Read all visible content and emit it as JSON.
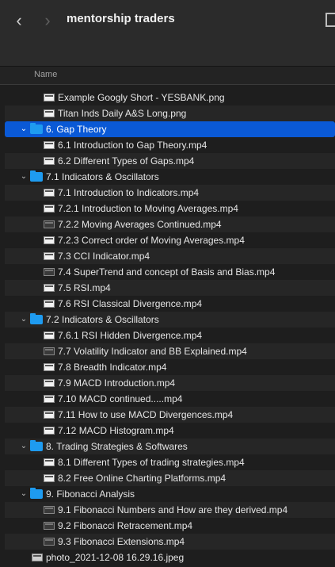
{
  "window": {
    "title": "mentorship traders",
    "column_name": "Name"
  },
  "items": [
    {
      "label": "Example Googly Short - YESBANK.png",
      "kind": "file",
      "indent": 2,
      "alt": false
    },
    {
      "label": "Titan Inds Daily A&S Long.png",
      "kind": "file",
      "indent": 2,
      "alt": true
    },
    {
      "label": "6. Gap Theory",
      "kind": "folder",
      "indent": 1,
      "expanded": true,
      "selected": true
    },
    {
      "label": "6.1 Introduction to Gap Theory.mp4",
      "kind": "file",
      "indent": 2,
      "alt": false
    },
    {
      "label": "6.2 Different Types of Gaps.mp4",
      "kind": "file",
      "indent": 2,
      "alt": true
    },
    {
      "label": "7.1 Indicators & Oscillators",
      "kind": "folder",
      "indent": 1,
      "expanded": true,
      "alt": false
    },
    {
      "label": "7.1 Introduction to Indicators.mp4",
      "kind": "file",
      "indent": 2,
      "alt": true
    },
    {
      "label": "7.2.1 Introduction to Moving Averages.mp4",
      "kind": "file",
      "indent": 2,
      "alt": false
    },
    {
      "label": "7.2.2 Moving Averages Continued.mp4",
      "kind": "file",
      "indent": 2,
      "alt": true,
      "dark": true
    },
    {
      "label": "7.2.3 Correct order of Moving Averages.mp4",
      "kind": "file",
      "indent": 2,
      "alt": false
    },
    {
      "label": "7.3 CCI Indicator.mp4",
      "kind": "file",
      "indent": 2,
      "alt": true
    },
    {
      "label": "7.4 SuperTrend and concept of Basis and Bias.mp4",
      "kind": "file",
      "indent": 2,
      "alt": false,
      "dark": true
    },
    {
      "label": "7.5 RSI.mp4",
      "kind": "file",
      "indent": 2,
      "alt": true
    },
    {
      "label": "7.6 RSI Classical Divergence.mp4",
      "kind": "file",
      "indent": 2,
      "alt": false
    },
    {
      "label": "7.2 Indicators & Oscillators",
      "kind": "folder",
      "indent": 1,
      "expanded": true,
      "alt": true
    },
    {
      "label": "7.6.1 RSI Hidden Divergence.mp4",
      "kind": "file",
      "indent": 2,
      "alt": false
    },
    {
      "label": "7.7 Volatility Indicator and BB Explained.mp4",
      "kind": "file",
      "indent": 2,
      "alt": true,
      "dark": true
    },
    {
      "label": "7.8 Breadth Indicator.mp4",
      "kind": "file",
      "indent": 2,
      "alt": false
    },
    {
      "label": "7.9 MACD Introduction.mp4",
      "kind": "file",
      "indent": 2,
      "alt": true
    },
    {
      "label": "7.10 MACD continued.....mp4",
      "kind": "file",
      "indent": 2,
      "alt": false
    },
    {
      "label": "7.11 How to use MACD Divergences.mp4",
      "kind": "file",
      "indent": 2,
      "alt": true
    },
    {
      "label": "7.12 MACD Histogram.mp4",
      "kind": "file",
      "indent": 2,
      "alt": false
    },
    {
      "label": "8. Trading Strategies & Softwares",
      "kind": "folder",
      "indent": 1,
      "expanded": true,
      "alt": true
    },
    {
      "label": "8.1 Different Types of trading strategies.mp4",
      "kind": "file",
      "indent": 2,
      "alt": false
    },
    {
      "label": "8.2 Free Online Charting Platforms.mp4",
      "kind": "file",
      "indent": 2,
      "alt": true
    },
    {
      "label": "9. Fibonacci Analysis",
      "kind": "folder",
      "indent": 1,
      "expanded": true,
      "alt": false
    },
    {
      "label": "9.1 Fibonacci Numbers and How are they derived.mp4",
      "kind": "file",
      "indent": 2,
      "alt": true,
      "dark": true
    },
    {
      "label": "9.2 Fibonacci Retracement.mp4",
      "kind": "file",
      "indent": 2,
      "alt": false,
      "dark": true
    },
    {
      "label": "9.3 Fibonacci Extensions.mp4",
      "kind": "file",
      "indent": 2,
      "alt": true,
      "dark": true
    },
    {
      "label": "photo_2021-12-08 16.29.16.jpeg",
      "kind": "image",
      "indent": 1,
      "alt": false
    }
  ]
}
